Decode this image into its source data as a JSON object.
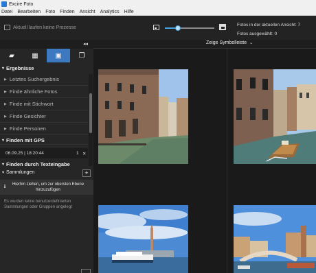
{
  "app": {
    "title": "Excire Foto"
  },
  "menu": [
    "Datei",
    "Bearbeiten",
    "Foto",
    "Finden",
    "Ansicht",
    "Analytics",
    "Hilfe"
  ],
  "toolbar": {
    "process_status": "Aktuell laufen keine Prozesse",
    "zoom_level": 0.26,
    "photos_in_view": "Fotos in der aktuellen Ansicht: 7",
    "photos_selected": "Fotos ausgewählt: 0"
  },
  "tabs": [
    {
      "icon": "folder-icon",
      "glyph": "▰"
    },
    {
      "icon": "people-calendar-icon",
      "glyph": "▦"
    },
    {
      "icon": "search-photo-icon",
      "glyph": "▣"
    },
    {
      "icon": "collections-icon",
      "glyph": "❐"
    }
  ],
  "sidebar": {
    "results_header": "Ergebnisse",
    "items": [
      "Letztes Suchergebnis",
      "Finde ähnliche Fotos",
      "Finde mit Stichwort",
      "Finde Gesichter",
      "Finde Personen"
    ],
    "gps_header": "Finden mit GPS",
    "gps_entry": {
      "date": "06.09.25 | 18:20:44",
      "count": "1",
      "remove": "✕"
    },
    "text_header": "Finden durch Texteingabe",
    "collections_header": "Sammlungen",
    "add_label": "+",
    "drop_zone": "Hierhin ziehen, um zur obersten Ebene hinzuzufügen",
    "empty_note": "Es wurden keine benutzerdefinierten Sammlungen oder Gruppen angelegt"
  },
  "content": {
    "symbol_bar_label": "Zeige Symbolleiste",
    "collapse_label": "◂◂",
    "photos": [
      {
        "name": "venice-canal-1"
      },
      {
        "name": "venice-canal-2"
      },
      {
        "name": "venice-lagoon-boat"
      },
      {
        "name": "venice-houses-bridge"
      }
    ]
  },
  "colors": {
    "accent": "#3d79c0",
    "slider": "#4aa3df",
    "background": "#1b1b1b",
    "sidebar": "#262626"
  }
}
